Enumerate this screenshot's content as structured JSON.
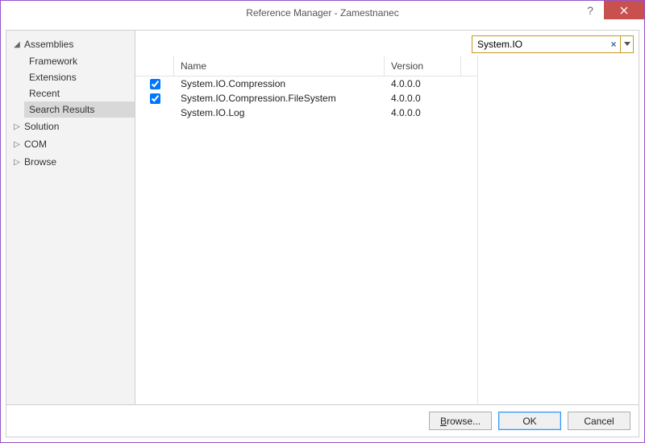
{
  "window": {
    "title": "Reference Manager - Zamestnanec"
  },
  "sidebar": {
    "categories": [
      {
        "label": "Assemblies",
        "expanded": true,
        "items": [
          {
            "label": "Framework"
          },
          {
            "label": "Extensions"
          },
          {
            "label": "Recent"
          },
          {
            "label": "Search Results",
            "selected": true
          }
        ]
      },
      {
        "label": "Solution",
        "expanded": false
      },
      {
        "label": "COM",
        "expanded": false
      },
      {
        "label": "Browse",
        "expanded": false
      }
    ]
  },
  "search": {
    "value": "System.IO",
    "clear_glyph": "×"
  },
  "columns": {
    "name": "Name",
    "version": "Version"
  },
  "results": [
    {
      "checked": true,
      "name": "System.IO.Compression",
      "version": "4.0.0.0"
    },
    {
      "checked": true,
      "name": "System.IO.Compression.FileSystem",
      "version": "4.0.0.0"
    },
    {
      "checked": false,
      "name": "System.IO.Log",
      "version": "4.0.0.0"
    }
  ],
  "footer": {
    "browse": "Browse...",
    "ok": "OK",
    "cancel": "Cancel"
  }
}
